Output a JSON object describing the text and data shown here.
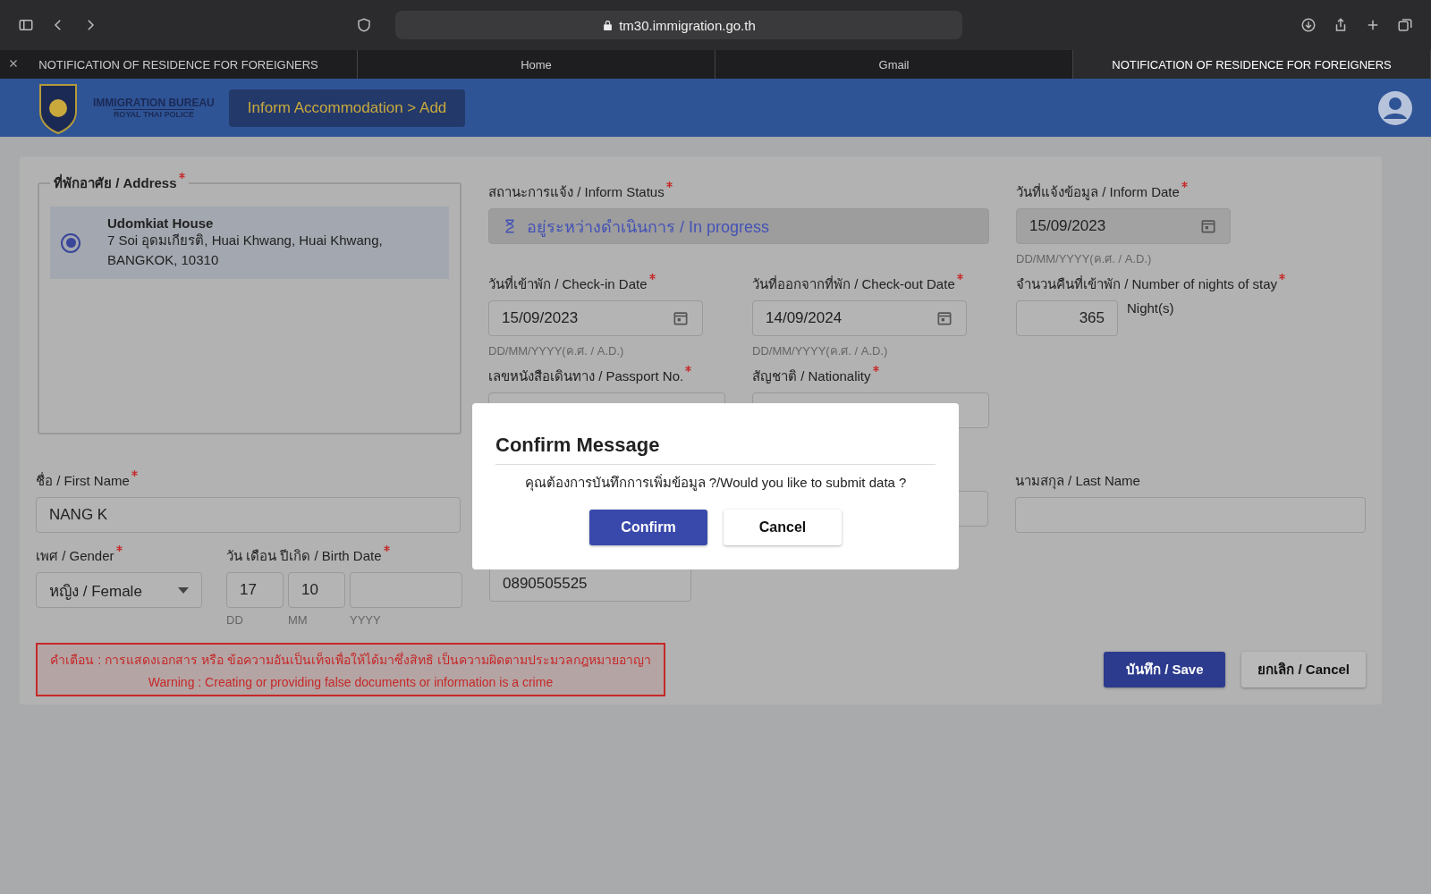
{
  "browser": {
    "url": "tm30.immigration.go.th",
    "tabs": [
      {
        "title": "NOTIFICATION OF RESIDENCE FOR FOREIGNERS",
        "selected": false,
        "closable": true
      },
      {
        "title": "Home",
        "selected": false,
        "closable": false
      },
      {
        "title": "Gmail",
        "selected": false,
        "closable": false
      },
      {
        "title": "NOTIFICATION OF RESIDENCE FOR FOREIGNERS",
        "selected": true,
        "closable": false
      }
    ]
  },
  "header": {
    "brand_title": "IMMIGRATION BUREAU",
    "brand_subtitle": "ROYAL THAI POLICE",
    "breadcrumb": "Inform Accommodation > Add"
  },
  "address": {
    "legend": "ที่พักอาศัย / Address",
    "required": true,
    "options": [
      {
        "name": "Udomkiat House",
        "address": "7 Soi อุดมเกียรติ, Huai Khwang, Huai Khwang, BANGKOK, 10310",
        "selected": true
      }
    ]
  },
  "form": {
    "inform_status": {
      "label": "สถานะการแจ้ง / Inform Status",
      "required": true,
      "value": "อยู่ระหว่างดำเนินการ / In progress"
    },
    "inform_date": {
      "label": "วันที่แจ้งข้อมูล / Inform Date",
      "required": true,
      "value": "15/09/2023",
      "hint": "DD/MM/YYYY(ค.ศ. / A.D.)"
    },
    "check_in": {
      "label": "วันที่เข้าพัก / Check-in Date",
      "required": true,
      "value": "15/09/2023",
      "hint": "DD/MM/YYYY(ค.ศ. / A.D.)"
    },
    "check_out": {
      "label": "วันที่ออกจากที่พัก / Check-out Date",
      "required": true,
      "value": "14/09/2024",
      "hint": "DD/MM/YYYY(ค.ศ. / A.D.)"
    },
    "nights": {
      "label": "จำนวนคืนที่เข้าพัก / Number of nights of stay",
      "required": true,
      "value": "365",
      "unit": "Night(s)"
    },
    "passport": {
      "label": "เลขหนังสือเดินทาง / Passport No.",
      "required": true
    },
    "nationality": {
      "label": "สัญชาติ / Nationality",
      "required": true
    },
    "first_name": {
      "label": "ชื่อ / First Name",
      "required": true,
      "value": "NANG K"
    },
    "last_name": {
      "label": "นามสกุล / Last Name",
      "required": false
    },
    "gender": {
      "label": "เพศ / Gender",
      "required": true,
      "value": "หญิง / Female"
    },
    "birth_date": {
      "label": "วัน เดือน ปีเกิด / Birth Date",
      "required": true,
      "day": "17",
      "month": "10",
      "hints": [
        "DD",
        "MM",
        "YYYY"
      ]
    },
    "phone": {
      "value": "0890505525"
    }
  },
  "warning": {
    "thai": "คำเตือน : การแสดงเอกสาร หรือ ข้อความอันเป็นเท็จเพื่อให้ได้มาซึ่งสิทธิ เป็นความผิดตามประมวลกฎหมายอาญา",
    "english": "Warning : Creating or providing false documents or information is a crime"
  },
  "actions": [
    {
      "label": "บันทึก / Save",
      "kind": "primary"
    },
    {
      "label": "ยกเลิก / Cancel",
      "kind": "secondary"
    }
  ],
  "dialog": {
    "title": "Confirm Message",
    "message": "คุณต้องการบันทึกการเพิ่มข้อมูล ?/Would you like to submit data ?",
    "buttons": [
      {
        "label": "Confirm",
        "kind": "primary"
      },
      {
        "label": "Cancel",
        "kind": "secondary"
      }
    ]
  }
}
